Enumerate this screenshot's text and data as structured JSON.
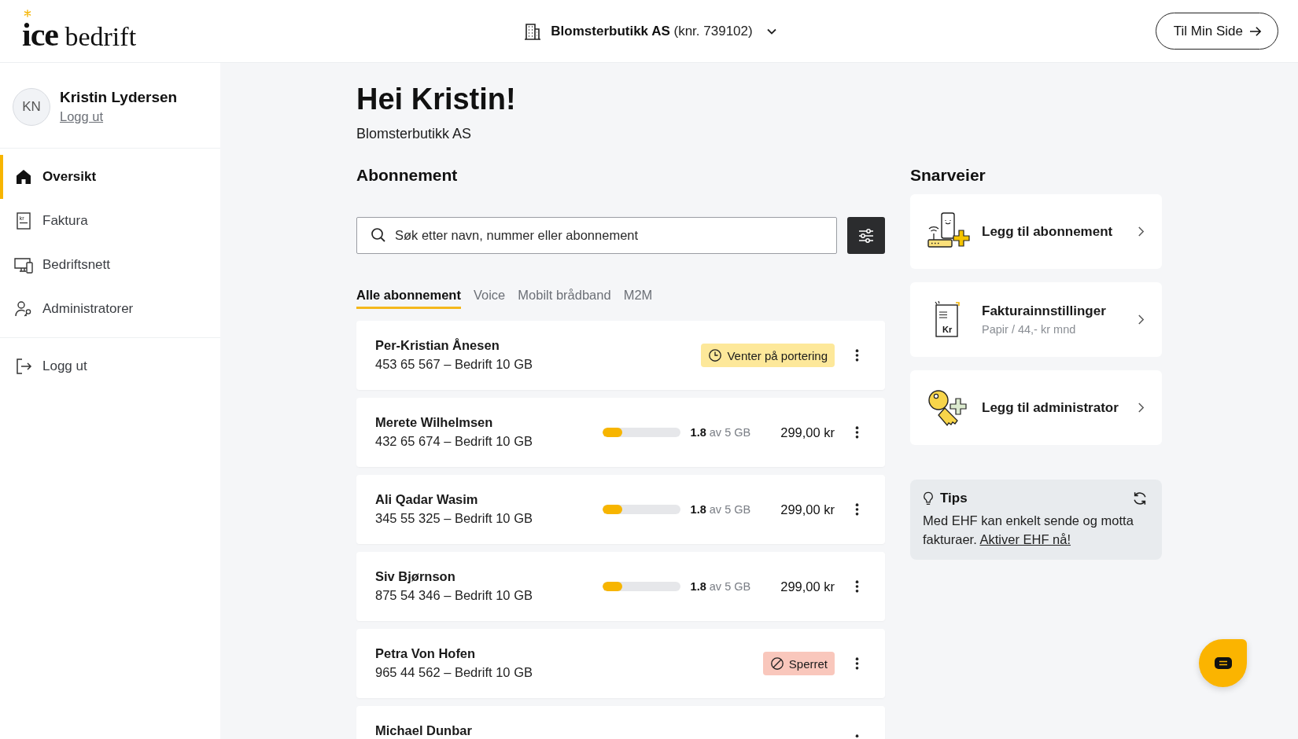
{
  "header": {
    "logo": "**ice** bedrift",
    "company": "**Blomsterbutikk AS** (knr. 739102)",
    "cta": "Til Min Side"
  },
  "user": {
    "initials": "KN",
    "name": "Kristin Lydersen",
    "logout": "Logg ut"
  },
  "nav": [
    {
      "label": "Oversikt",
      "selected": true
    },
    {
      "label": "Faktura",
      "selected": false,
      "icon_text": "kr"
    },
    {
      "label": "Bedriftsnett",
      "selected": false
    },
    {
      "label": "Administratorer",
      "selected": false
    }
  ],
  "sidebar_logout": {
    "label": "Logg ut"
  },
  "greeting": {
    "title": "Hei Kristin!",
    "company": "Blomsterbutikk AS"
  },
  "subscriptions": {
    "heading": "Abonnement",
    "search": {
      "placeholder": "Søk etter navn, nummer eller abonnement"
    },
    "tabs": [
      {
        "label": "Alle abonnement",
        "selected": true
      },
      {
        "label": "Voice",
        "selected": false
      },
      {
        "label": "Mobilt brådband",
        "selected": false
      },
      {
        "label": "M2M",
        "selected": false
      }
    ],
    "rows": [
      {
        "kind": "status",
        "name": "Per-Kristian Ånesen",
        "details": "453 65 567 – Bedrift 10 GB",
        "badge": {
          "kind": "pending",
          "text": "Venter på portering"
        }
      },
      {
        "kind": "usage",
        "name": "Merete Wilhelmsen",
        "details": "432 65 674 – Bedrift 10 GB",
        "level": 0.26,
        "usage": "**1.8** av 5 GB",
        "price": "299,00 kr"
      },
      {
        "kind": "usage",
        "name": "Ali Qadar Wasim",
        "details": "345 55 325 – Bedrift 10 GB",
        "level": 0.26,
        "usage": "**1.8** av 5 GB",
        "price": "299,00 kr"
      },
      {
        "kind": "usage",
        "name": "Siv Bjørnson",
        "details": "875 54 346 – Bedrift 10 GB",
        "level": 0.26,
        "usage": "**1.8** av 5 GB",
        "price": "299,00 kr"
      },
      {
        "kind": "status",
        "name": "Petra Von Hofen",
        "details": "965 44 562 – Bedrift 10 GB",
        "badge": {
          "kind": "blocked",
          "text": "Sperret"
        }
      },
      {
        "kind": "status",
        "name": "Michael Dunbar"
      }
    ]
  },
  "shortcuts": {
    "heading": "Snarveier",
    "items": [
      {
        "title": "Legg til abonnement"
      },
      {
        "title": "Fakturainnstillinger",
        "subtitle": "Papir / 44,- kr mnd",
        "icon_text": "Kr"
      },
      {
        "title": "Legg til administrator"
      }
    ]
  },
  "tips": {
    "title": "Tips",
    "text": "Med EHF kan enkelt sende og motta fakturaer.",
    "link": "Aktiver EHF nå!"
  }
}
